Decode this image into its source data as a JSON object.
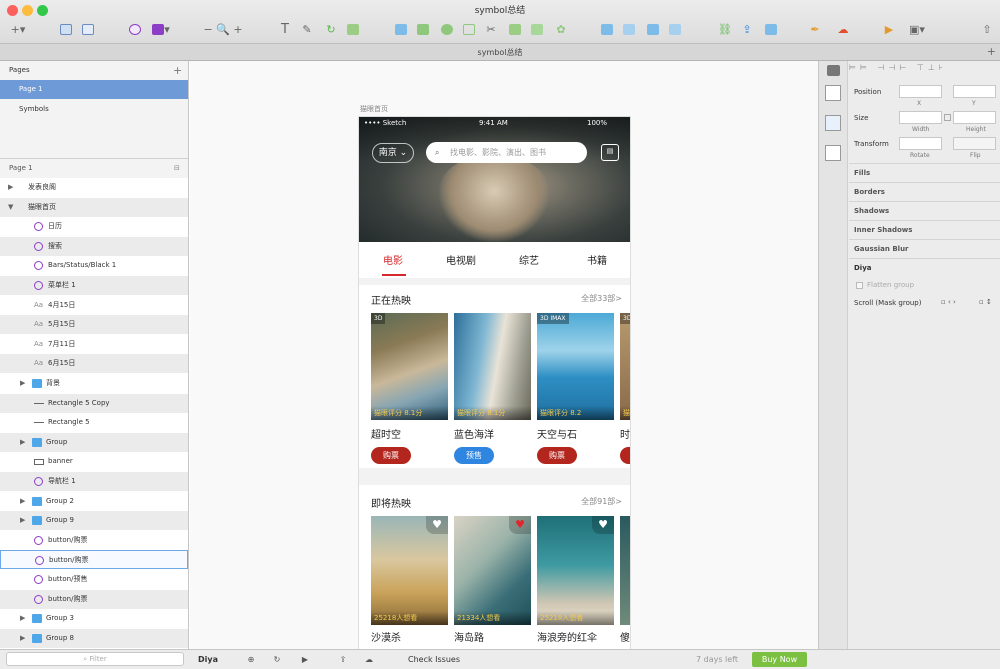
{
  "titlebar": {
    "document": "symbol总结"
  },
  "tabbar": {
    "title": "symbol总结"
  },
  "pages": {
    "header": "Pages",
    "add": "+",
    "items": [
      {
        "label": "Page 1",
        "selected": true
      },
      {
        "label": "Symbols",
        "selected": false
      }
    ]
  },
  "layers": {
    "header": "Page 1",
    "items": [
      {
        "label": "发表良阁",
        "type": "group"
      },
      {
        "label": "猫眼首页",
        "type": "group-open"
      },
      {
        "label": "日历",
        "type": "symbol"
      },
      {
        "label": "搜索",
        "type": "symbol"
      },
      {
        "label": "Bars/Status/Black 1",
        "type": "symbol"
      },
      {
        "label": "菜单栏 1",
        "type": "symbol"
      },
      {
        "label": "4月15日",
        "type": "text"
      },
      {
        "label": "5月15日",
        "type": "text"
      },
      {
        "label": "7月11日",
        "type": "text"
      },
      {
        "label": "6月15日",
        "type": "text"
      },
      {
        "label": "背景",
        "type": "folder"
      },
      {
        "label": "Rectangle 5 Copy",
        "type": "line"
      },
      {
        "label": "Rectangle 5",
        "type": "line"
      },
      {
        "label": "Group",
        "type": "folder"
      },
      {
        "label": "banner",
        "type": "rect"
      },
      {
        "label": "导航栏 1",
        "type": "symbol"
      },
      {
        "label": "Group 2",
        "type": "folder"
      },
      {
        "label": "Group 9",
        "type": "folder"
      },
      {
        "label": "button/购票",
        "type": "symbol"
      },
      {
        "label": "button/购票",
        "type": "symbol",
        "highlighted": true
      },
      {
        "label": "button/预售",
        "type": "symbol"
      },
      {
        "label": "button/购票",
        "type": "symbol"
      },
      {
        "label": "Group 3",
        "type": "folder"
      },
      {
        "label": "Group 8",
        "type": "folder"
      }
    ],
    "filter_placeholder": "Filter"
  },
  "canvas": {
    "artboard_label": "猫眼首页"
  },
  "phone": {
    "status": {
      "carrier": "•••• Sketch",
      "time": "9:41 AM",
      "battery": "100%"
    },
    "city": "南京",
    "search_placeholder": "找电影、影院、演出、图书",
    "tabs": [
      "电影",
      "电视剧",
      "综艺",
      "书籍"
    ],
    "now_showing": {
      "title": "正在热映",
      "more": "全部33部",
      "movies": [
        {
          "badge": "3D",
          "score": "猫眼评分 8.1分",
          "name": "超时空",
          "button": "购票",
          "btn_color": "#b3261e"
        },
        {
          "badge": "",
          "score": "猫眼评分 8.1分",
          "name": "蓝色海洋",
          "button": "预售",
          "btn_color": "#2f86e0"
        },
        {
          "badge": "3D IMAX",
          "score": "猫眼评分 8.2",
          "name": "天空与石",
          "button": "购票",
          "btn_color": "#b3261e"
        },
        {
          "badge": "3D",
          "score": "猫眼评分",
          "name": "时",
          "button": "",
          "btn_color": "#b3261e"
        }
      ]
    },
    "coming_soon": {
      "title": "即将热映",
      "more": "全部91部",
      "movies": [
        {
          "wish": "25218人想看",
          "name": "沙漠杀",
          "heart": "♥",
          "heart_color": "#ffffff"
        },
        {
          "wish": "21334人想看",
          "name": "海岛路",
          "heart": "♥",
          "heart_color": "#e0262c"
        },
        {
          "wish": "25218人想看",
          "name": "海浪旁的红伞",
          "heart": "♥",
          "heart_color": "#ffffff"
        },
        {
          "wish": "",
          "name": "傻",
          "heart": "",
          "heart_color": "#ffffff"
        }
      ]
    }
  },
  "inspector": {
    "position": "Position",
    "x": "X",
    "y": "Y",
    "size": "Size",
    "width": "Width",
    "height": "Height",
    "transform": "Transform",
    "rotate": "Rotate",
    "flip": "Flip",
    "sections": [
      "Fills",
      "Borders",
      "Shadows",
      "Inner Shadows",
      "Gaussian Blur"
    ],
    "symbol_name": "Diya",
    "flatten": "Flatten group",
    "scroll": "Scroll (Mask group)"
  },
  "footer": {
    "name": "Diya",
    "check": "Check Issues",
    "trial": "7 days left",
    "buy": "Buy Now"
  }
}
